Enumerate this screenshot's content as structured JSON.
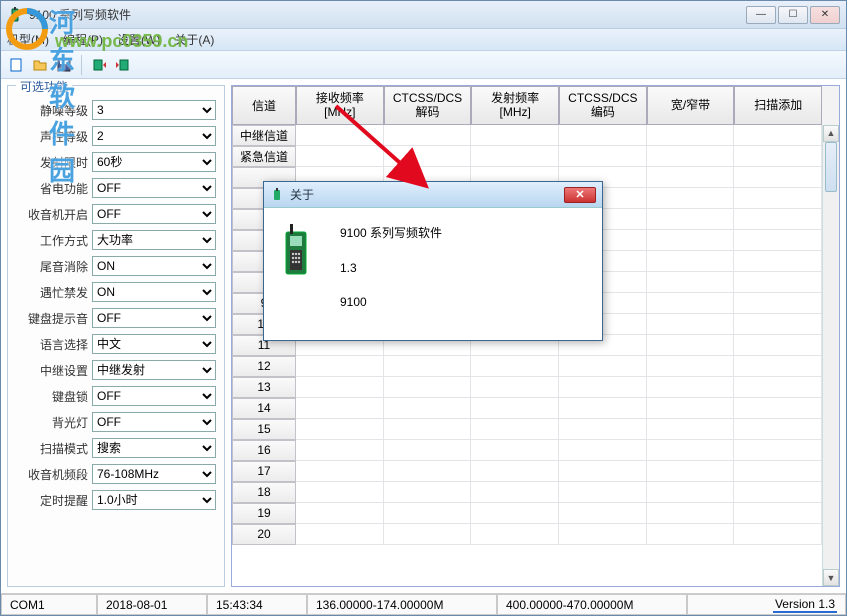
{
  "window": {
    "title": "9100 系列写频软件"
  },
  "menu": {
    "items": [
      "机型(M)",
      "编程(P)",
      "设置(W)",
      "关于(A)"
    ]
  },
  "watermark": {
    "text": "河东软件园",
    "url": "www.pc0359.cn"
  },
  "panel": {
    "title": "可选功能",
    "rows": [
      {
        "label": "静噪等级",
        "value": "3"
      },
      {
        "label": "声控等级",
        "value": "2"
      },
      {
        "label": "发射限时",
        "value": "60秒"
      },
      {
        "label": "省电功能",
        "value": "OFF"
      },
      {
        "label": "收音机开启",
        "value": "OFF"
      },
      {
        "label": "工作方式",
        "value": "大功率"
      },
      {
        "label": "尾音消除",
        "value": "ON"
      },
      {
        "label": "遇忙禁发",
        "value": "ON"
      },
      {
        "label": "键盘提示音",
        "value": "OFF"
      },
      {
        "label": "语言选择",
        "value": "中文"
      },
      {
        "label": "中继设置",
        "value": "中继发射"
      },
      {
        "label": "键盘锁",
        "value": "OFF"
      },
      {
        "label": "背光灯",
        "value": "OFF"
      },
      {
        "label": "扫描模式",
        "value": "搜索"
      },
      {
        "label": "收音机频段",
        "value": "76-108MHz"
      },
      {
        "label": "定时提醒",
        "value": "1.0小时"
      }
    ]
  },
  "grid": {
    "corner": "信道",
    "columns": [
      {
        "l1": "接收频率",
        "l2": "[MHz]"
      },
      {
        "l1": "CTCSS/DCS",
        "l2": "解码"
      },
      {
        "l1": "发射频率",
        "l2": "[MHz]"
      },
      {
        "l1": "CTCSS/DCS",
        "l2": "编码"
      },
      {
        "l1": "宽/窄带",
        "l2": ""
      },
      {
        "l1": "扫描添加",
        "l2": ""
      }
    ],
    "row_headers": [
      "中继信道",
      "紧急信道",
      "",
      "",
      "",
      "",
      "",
      "",
      "9",
      "10",
      "11",
      "12",
      "13",
      "14",
      "15",
      "16",
      "17",
      "18",
      "19",
      "20"
    ]
  },
  "dialog": {
    "title": "关于",
    "line1": "9100 系列写频软件",
    "line2": "1.3",
    "line3": "9100"
  },
  "statusbar": {
    "port": "COM1",
    "date": "2018-08-01",
    "time": "15:43:34",
    "range1": "136.00000-174.00000M",
    "range2": "400.00000-470.00000M",
    "version": "Version 1.3"
  }
}
